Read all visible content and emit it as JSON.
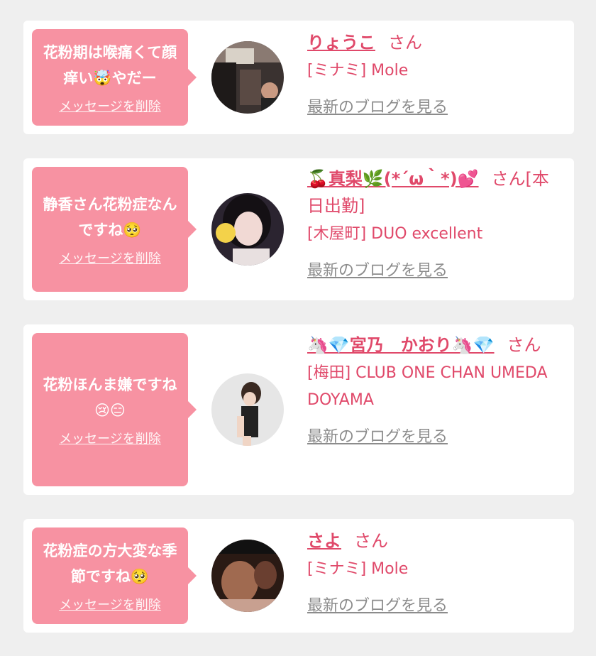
{
  "colors": {
    "page_bg": "#efefef",
    "card_bg": "#ffffff",
    "bubble_bg": "#f792a2",
    "accent": "#e0496a",
    "link_gray": "#8c8c8c"
  },
  "entries": [
    {
      "message": "花粉期は喉痛くて顔痒い🤯やだー",
      "delete_label": "メッセージを削除",
      "name": "りょうこ",
      "honorific": "さん",
      "shop": "[ミナミ] Mole",
      "blog_label": "最新のブログを見る"
    },
    {
      "message": "静香さん花粉症なんですね🥺",
      "delete_label": "メッセージを削除",
      "name": "🍒真梨🌿(*´ω｀*)💕",
      "honorific": "さん[本日出勤]",
      "shop": "[木屋町] DUO excellent",
      "blog_label": "最新のブログを見る"
    },
    {
      "message": "花粉ほんま嫌ですね😢😑",
      "delete_label": "メッセージを削除",
      "name": "🦄💎宮乃　かおり🦄💎",
      "honorific": "さん",
      "shop": "[梅田] CLUB ONE CHAN UMEDA DOYAMA",
      "blog_label": "最新のブログを見る"
    },
    {
      "message": "花粉症の方大変な季節ですね🥺",
      "delete_label": "メッセージを削除",
      "name": "さよ",
      "honorific": "さん",
      "shop": "[ミナミ] Mole",
      "blog_label": "最新のブログを見る"
    }
  ]
}
